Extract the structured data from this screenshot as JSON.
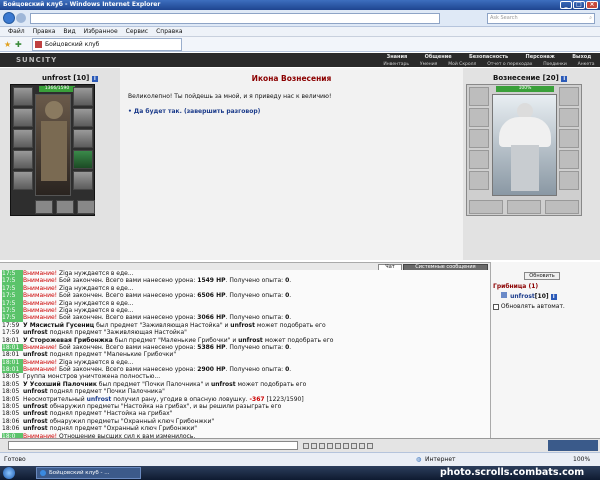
{
  "window": {
    "title": "Бойцовский клуб - Windows Internet Explorer"
  },
  "browser": {
    "search_placeholder": "Ask Search",
    "menu": [
      "Файл",
      "Правка",
      "Вид",
      "Избранное",
      "Сервис",
      "Справка"
    ],
    "tab_label": "Бойцовский клуб"
  },
  "game": {
    "logo": "SUNCITY",
    "top_menu": [
      "Знания",
      "Общение",
      "Безопасность",
      "Персонаж",
      "Выход"
    ],
    "sub_menu": [
      "Инвентарь",
      "Умения",
      "Мой Скролл",
      "Отчет о переходах",
      "Поединки",
      "Анкета"
    ],
    "player": {
      "name": "unfrost",
      "level": "[10]",
      "hp": "1366/1590"
    },
    "npc": {
      "name": "Вознесение",
      "level": "[20]",
      "hp": "100%"
    },
    "dialog": {
      "title": "Икона Вознесения",
      "text": "Великолепно! Ты пойдешь за мной, и я приведу нас к величию!",
      "link": "• Да будет так. (завершить разговор)"
    }
  },
  "chat": {
    "tabs": [
      "Чат",
      "Системные сообщения"
    ],
    "lines": [
      {
        "t": "17:5",
        "hl": true,
        "parts": [
          [
            "w",
            "Внимание!"
          ],
          [
            "n",
            " Ziga нуждается в еде..."
          ]
        ]
      },
      {
        "t": "17:5",
        "hl": true,
        "parts": [
          [
            "w",
            "Внимание!"
          ],
          [
            "n",
            " Бой закончен. Всего вами нанесено урона: "
          ],
          [
            "b",
            "1549 HP"
          ],
          [
            "n",
            ". Получено опыта: "
          ],
          [
            "b",
            "0"
          ],
          [
            "n",
            "."
          ]
        ]
      },
      {
        "t": "17:5",
        "hl": true,
        "parts": [
          [
            "w",
            "Внимание!"
          ],
          [
            "n",
            " Ziga нуждается в еде..."
          ]
        ]
      },
      {
        "t": "17:5",
        "hl": true,
        "parts": [
          [
            "w",
            "Внимание!"
          ],
          [
            "n",
            " Бой закончен. Всего вами нанесено урона: "
          ],
          [
            "b",
            "6506 HP"
          ],
          [
            "n",
            ". Получено опыта: "
          ],
          [
            "b",
            "0"
          ],
          [
            "n",
            "."
          ]
        ]
      },
      {
        "t": "17:5",
        "hl": true,
        "parts": [
          [
            "w",
            "Внимание!"
          ],
          [
            "n",
            " Ziga нуждается в еде..."
          ]
        ]
      },
      {
        "t": "17:5",
        "hl": true,
        "parts": [
          [
            "w",
            "Внимание!"
          ],
          [
            "n",
            " Ziga нуждается в еде..."
          ]
        ]
      },
      {
        "t": "17:5",
        "hl": true,
        "parts": [
          [
            "w",
            "Внимание!"
          ],
          [
            "n",
            " Бой закончен. Всего вами нанесено урона: "
          ],
          [
            "b",
            "3066 HP"
          ],
          [
            "n",
            ". Получено опыта: "
          ],
          [
            "b",
            "0"
          ],
          [
            "n",
            "."
          ]
        ]
      },
      {
        "t": "17:59",
        "hl": false,
        "parts": [
          [
            "b",
            "У Мясистый Гусениц"
          ],
          [
            "n",
            " был предмет \"Заживляющая Настойка\" и "
          ],
          [
            "b",
            "unfrost"
          ],
          [
            "n",
            " может подобрать его"
          ]
        ]
      },
      {
        "t": "17:59",
        "hl": false,
        "parts": [
          [
            "b",
            "unfrost"
          ],
          [
            "n",
            " поднял предмет \"Заживляющая Настойка\""
          ]
        ]
      },
      {
        "t": "18:01",
        "hl": false,
        "parts": [
          [
            "b",
            "У Сторожевая Грибонжка"
          ],
          [
            "n",
            " был предмет \"Маленькие Грибочки\" и "
          ],
          [
            "b",
            "unfrost"
          ],
          [
            "n",
            " может подобрать его"
          ]
        ]
      },
      {
        "t": "18:01",
        "hl": true,
        "parts": [
          [
            "w",
            "Внимание!"
          ],
          [
            "n",
            " Бой закончен. Всего вами нанесено урона: "
          ],
          [
            "b",
            "5386 HP"
          ],
          [
            "n",
            ". Получено опыта: "
          ],
          [
            "b",
            "0"
          ],
          [
            "n",
            "."
          ]
        ]
      },
      {
        "t": "18:01",
        "hl": false,
        "parts": [
          [
            "b",
            "unfrost"
          ],
          [
            "n",
            " поднял предмет \"Маленькие Грибочки\""
          ]
        ]
      },
      {
        "t": "18:01",
        "hl": true,
        "parts": [
          [
            "w",
            "Внимание!"
          ],
          [
            "n",
            " Ziga нуждается в еде..."
          ]
        ]
      },
      {
        "t": "18:01",
        "hl": true,
        "parts": [
          [
            "w",
            "Внимание!"
          ],
          [
            "n",
            " Бой закончен. Всего вами нанесено урона: "
          ],
          [
            "b",
            "2900 HP"
          ],
          [
            "n",
            ". Получено опыта: "
          ],
          [
            "b",
            "0"
          ],
          [
            "n",
            "."
          ]
        ]
      },
      {
        "t": "18:05",
        "hl": false,
        "parts": [
          [
            "n",
            "Группа монстров уничтожена полностью..."
          ]
        ]
      },
      {
        "t": "18:05",
        "hl": false,
        "parts": [
          [
            "b",
            "У Усохший Палочник"
          ],
          [
            "n",
            " был предмет \"Почки Палочника\" и "
          ],
          [
            "b",
            "unfrost"
          ],
          [
            "n",
            " может подобрать его"
          ]
        ]
      },
      {
        "t": "18:05",
        "hl": false,
        "parts": [
          [
            "b",
            "unfrost"
          ],
          [
            "n",
            " поднял предмет \"Почки Палочника\""
          ]
        ]
      },
      {
        "t": "18:05",
        "hl": false,
        "parts": [
          [
            "n",
            "Неосмотрительный "
          ],
          [
            "bb",
            "unfrost"
          ],
          [
            "n",
            " получил рану, угодив в опасную ловушку. "
          ],
          [
            "r",
            "-367"
          ],
          [
            "n",
            " [1223/1590]"
          ]
        ]
      },
      {
        "t": "18:05",
        "hl": false,
        "parts": [
          [
            "b",
            "unfrost"
          ],
          [
            "n",
            " обнаружил предметы \"Настойка на грибах\", и вы решили разыграть его"
          ]
        ]
      },
      {
        "t": "18:05",
        "hl": false,
        "parts": [
          [
            "b",
            "unfrost"
          ],
          [
            "n",
            " поднял предмет \"Настойка на грибах\""
          ]
        ]
      },
      {
        "t": "18:06",
        "hl": false,
        "parts": [
          [
            "b",
            "unfrost"
          ],
          [
            "n",
            " обнаружил предметы \"Охранный ключ Грибонжки\""
          ]
        ]
      },
      {
        "t": "18:06",
        "hl": false,
        "parts": [
          [
            "b",
            "unfrost"
          ],
          [
            "n",
            " поднял предмет \"Охранный ключ Грибонжки\""
          ]
        ]
      },
      {
        "t": "18:0",
        "hl": true,
        "parts": [
          [
            "w",
            "Внимание!"
          ],
          [
            "n",
            " Отношение высших сил к вам изменилось."
          ]
        ]
      }
    ]
  },
  "right": {
    "refresh": "Обновить",
    "location": "Грибница (1)",
    "player": "unfrost",
    "player_level": "[10]",
    "auto_label": "Обновлять автомат."
  },
  "status": {
    "left": "Готово",
    "zone": "Интернет",
    "zoom": "100%"
  },
  "taskbar": {
    "task": "Бойцовский клуб - ...",
    "clock": "18:06"
  },
  "watermark": "photo.scrolls.combats.com",
  "colors": {
    "accent_red": "#8b0000",
    "warn": "#cc0000",
    "highlight": "#5ac36a"
  }
}
